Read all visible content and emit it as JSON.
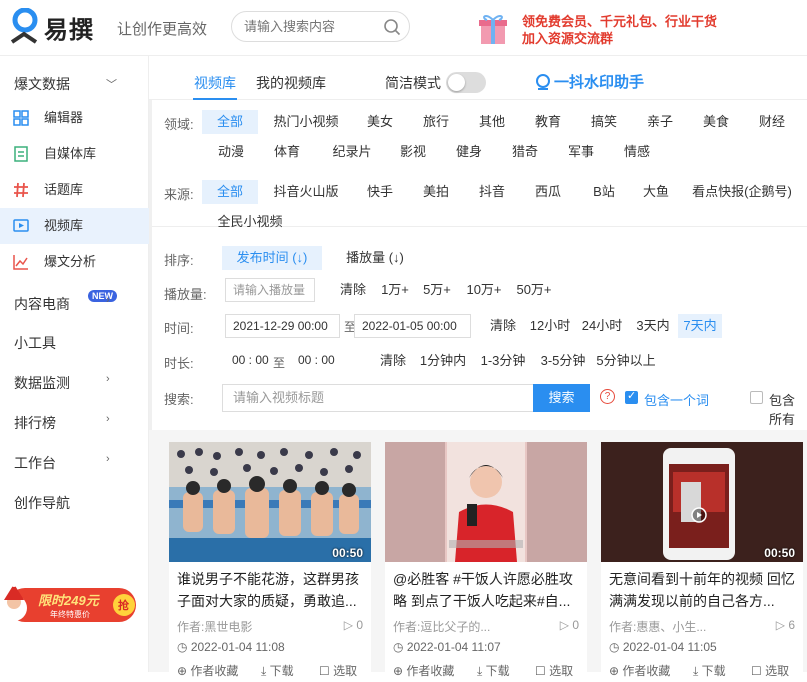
{
  "header": {
    "logo_text": "易撰",
    "slogan": "让创作更高效",
    "search_placeholder": "请输入搜索内容",
    "promo_line1": "领免费会员、千元礼包、行业干货",
    "promo_line2": "加入资源交流群"
  },
  "sidebar": {
    "group_viral": "爆文数据",
    "items": [
      {
        "label": "编辑器",
        "icon": "grid-icon"
      },
      {
        "label": "自媒体库",
        "icon": "document-icon"
      },
      {
        "label": "话题库",
        "icon": "hashtag-icon"
      },
      {
        "label": "视频库",
        "icon": "video-icon"
      },
      {
        "label": "爆文分析",
        "icon": "chart-line-icon"
      }
    ],
    "groups": [
      {
        "label": "内容电商",
        "badge": "NEW"
      },
      {
        "label": "小工具"
      },
      {
        "label": "数据监测"
      },
      {
        "label": "排行榜"
      },
      {
        "label": "工作台"
      },
      {
        "label": "创作导航"
      }
    ],
    "sale_text": "限时249元",
    "sale_sub": "年终特惠价",
    "sale_tag": "抢"
  },
  "tabs": {
    "video_library": "视频库",
    "my_library": "我的视频库",
    "simple_mode": "简洁模式",
    "watermark_helper": "一抖水印助手"
  },
  "filters": {
    "domain_label": "领域:",
    "domains_row1": [
      "全部",
      "热门小视频",
      "美女",
      "旅行",
      "其他",
      "教育",
      "搞笑",
      "亲子",
      "美食",
      "财经"
    ],
    "domains_row2": [
      "动漫",
      "体育",
      "纪录片",
      "影视",
      "健身",
      "猎奇",
      "军事",
      "情感"
    ],
    "source_label": "来源:",
    "sources_row1": [
      "全部",
      "抖音火山版",
      "快手",
      "美拍",
      "抖音",
      "西瓜",
      "B站",
      "大鱼",
      "看点快报(企鹅号)"
    ],
    "sources_row2": [
      "全民小视频"
    ],
    "sort_label": "排序:",
    "sort_options": [
      "发布时间 (↓)",
      "播放量 (↓)"
    ],
    "plays_label": "播放量:",
    "plays_placeholder": "请输入播放量",
    "plays_options": [
      "清除",
      "1万+",
      "5万+",
      "10万+",
      "50万+"
    ],
    "time_label": "时间:",
    "time_start": "2021-12-29 00:00",
    "time_to": "至",
    "time_end": "2022-01-05 00:00",
    "time_options": [
      "清除",
      "12小时",
      "24小时",
      "3天内",
      "7天内"
    ],
    "duration_label": "时长:",
    "duration_start": "00 : 00",
    "duration_to": "至",
    "duration_end": "00 : 00",
    "duration_options": [
      "清除",
      "1分钟内",
      "1-3分钟",
      "3-5分钟",
      "5分钟以上"
    ],
    "search_label": "搜索:",
    "search_placeholder": "请输入视频标题",
    "search_button": "搜索",
    "include_one": "包含一个词",
    "include_all": "包含所有"
  },
  "cards": [
    {
      "duration": "00:50",
      "title": "谁说男子不能花游，这群男孩子面对大家的质疑，勇敢追...",
      "author": "作者:黑世电影",
      "count": "0",
      "date": "2022-01-04 11:08",
      "act_collect": "作者收藏",
      "act_download": "下载",
      "act_select": "选取"
    },
    {
      "duration": "",
      "title": "@必胜客 #干饭人许愿必胜攻略 到点了干饭人吃起来#自...",
      "author": "作者:逗比父子的...",
      "count": "0",
      "date": "2022-01-04 11:07",
      "act_collect": "作者收藏",
      "act_download": "下载",
      "act_select": "选取"
    },
    {
      "duration": "00:50",
      "title": "无意间看到十前年的视频 回忆满满发现以前的自己各方...",
      "author": "作者:惠惠、小生...",
      "count": "6",
      "date": "2022-01-04 11:05",
      "act_collect": "作者收藏",
      "act_download": "下载",
      "act_select": "选取"
    }
  ],
  "colors": {
    "accent": "#2a8ef0",
    "promo": "#e23b2e"
  }
}
